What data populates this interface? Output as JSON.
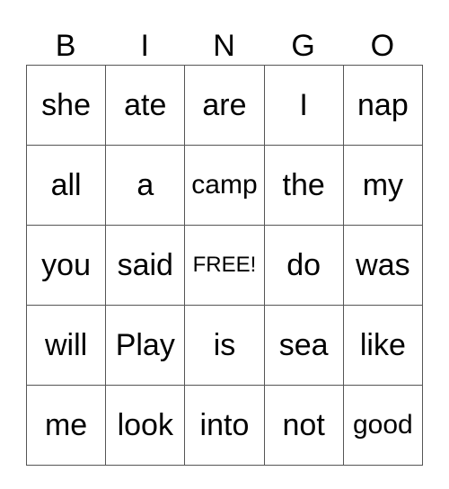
{
  "header": [
    "B",
    "I",
    "N",
    "G",
    "O"
  ],
  "rows": [
    [
      "she",
      "ate",
      "are",
      "I",
      "nap"
    ],
    [
      "all",
      "a",
      "camp",
      "the",
      "my"
    ],
    [
      "you",
      "said",
      "FREE!",
      "do",
      "was"
    ],
    [
      "will",
      "Play",
      "is",
      "sea",
      "like"
    ],
    [
      "me",
      "look",
      "into",
      "not",
      "good"
    ]
  ]
}
